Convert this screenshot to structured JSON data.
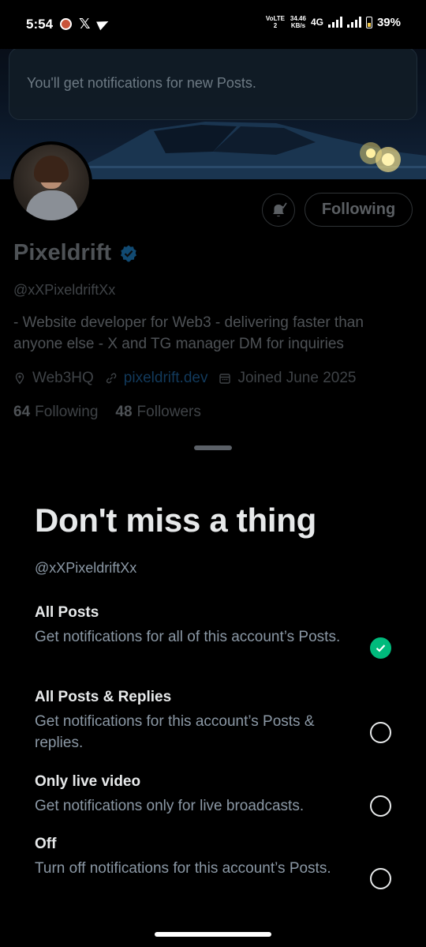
{
  "status_bar": {
    "time": "5:54",
    "volte": "VoLTE2",
    "speed_value": "34.46",
    "speed_unit": "KB/s",
    "network": "4G",
    "battery": "39%"
  },
  "toast": {
    "text": "You'll get notifications for new Posts."
  },
  "profile": {
    "follow_button": "Following",
    "name": "Pixeldrift",
    "handle": "@xXPixeldriftXx",
    "bio": "- Website developer for Web3 - delivering faster than anyone else - X and TG manager  DM for inquiries",
    "location": "Web3HQ",
    "website": "pixeldrift.dev",
    "joined": "Joined June 2025",
    "following_count": "64",
    "following_label": "Following",
    "followers_count": "48",
    "followers_label": "Followers"
  },
  "sheet": {
    "title": "Don't miss a thing",
    "handle": "@xXPixeldriftXx",
    "options": [
      {
        "title": "All Posts",
        "desc": "Get notifications for all of this account’s Posts.",
        "selected": true
      },
      {
        "title": "All Posts & Replies",
        "desc": "Get notifications for this account’s Posts & replies.",
        "selected": false
      },
      {
        "title": "Only live video",
        "desc": "Get notifications only for live broadcasts.",
        "selected": false
      },
      {
        "title": "Off",
        "desc": "Turn off notifications for this account’s Posts.",
        "selected": false
      }
    ]
  },
  "colors": {
    "accent": "#00ba7c",
    "verified": "#1d9bf0",
    "link": "#1d9bf0"
  }
}
